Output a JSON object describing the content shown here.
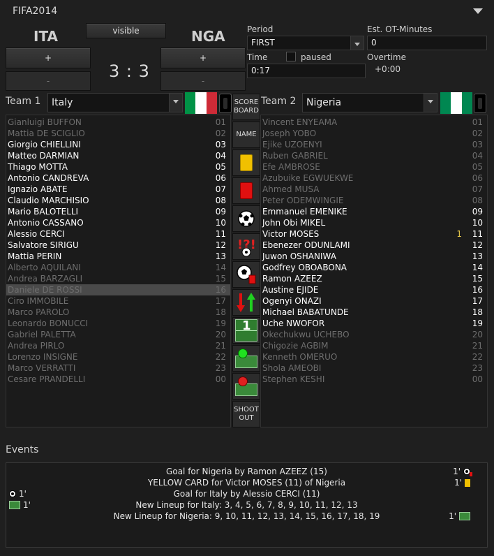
{
  "app": {
    "title": "FIFA2014"
  },
  "header": {
    "home_code": "ITA",
    "away_code": "NGA",
    "visible_label": "visible",
    "plus_label": "+",
    "minus_label": "-",
    "score": "3 : 3"
  },
  "period": {
    "label": "Period",
    "value": "FIRST"
  },
  "time": {
    "label": "Time",
    "value": "0:17",
    "paused_label": "paused",
    "paused": false
  },
  "ot_minutes": {
    "label": "Est. OT-Minutes",
    "value": "0"
  },
  "overtime": {
    "label": "Overtime",
    "value": "+0:00"
  },
  "team1": {
    "label": "Team 1",
    "name": "Italy",
    "flag_colors": [
      "#009246",
      "#ffffff",
      "#ce2b37"
    ],
    "players": [
      {
        "name": "Gianluigi BUFFON",
        "num": "01",
        "state": "inactive"
      },
      {
        "name": "Mattia DE SCIGLIO",
        "num": "02",
        "state": "inactive"
      },
      {
        "name": "Giorgio CHIELLINI",
        "num": "03",
        "state": "active"
      },
      {
        "name": "Matteo DARMIAN",
        "num": "04",
        "state": "active"
      },
      {
        "name": "Thiago MOTTA",
        "num": "05",
        "state": "active"
      },
      {
        "name": "Antonio CANDREVA",
        "num": "06",
        "state": "active"
      },
      {
        "name": "Ignazio ABATE",
        "num": "07",
        "state": "active"
      },
      {
        "name": "Claudio MARCHISIO",
        "num": "08",
        "state": "active"
      },
      {
        "name": "Mario BALOTELLI",
        "num": "09",
        "state": "active"
      },
      {
        "name": "Antonio CASSANO",
        "num": "10",
        "state": "active"
      },
      {
        "name": "Alessio CERCI",
        "num": "11",
        "state": "active"
      },
      {
        "name": "Salvatore SIRIGU",
        "num": "12",
        "state": "active"
      },
      {
        "name": "Mattia PERIN",
        "num": "13",
        "state": "active"
      },
      {
        "name": "Alberto AQUILANI",
        "num": "14",
        "state": "inactive"
      },
      {
        "name": "Andrea BARZAGLI",
        "num": "15",
        "state": "inactive"
      },
      {
        "name": "Daniele DE ROSSI",
        "num": "16",
        "state": "inactive",
        "selected": true
      },
      {
        "name": "Ciro IMMOBILE",
        "num": "17",
        "state": "inactive"
      },
      {
        "name": "Marco PAROLO",
        "num": "18",
        "state": "inactive"
      },
      {
        "name": "Leonardo BONUCCI",
        "num": "19",
        "state": "inactive"
      },
      {
        "name": "Gabriel PALETTA",
        "num": "20",
        "state": "inactive"
      },
      {
        "name": "Andrea PIRLO",
        "num": "21",
        "state": "inactive"
      },
      {
        "name": "Lorenzo INSIGNE",
        "num": "22",
        "state": "inactive"
      },
      {
        "name": "Marco VERRATTI",
        "num": "23",
        "state": "inactive"
      },
      {
        "name": "Cesare PRANDELLI",
        "num": "00",
        "state": "inactive"
      }
    ]
  },
  "team2": {
    "label": "Team 2",
    "name": "Nigeria",
    "flag_colors": [
      "#008751",
      "#ffffff",
      "#008751"
    ],
    "players": [
      {
        "name": "Vincent ENYEAMA",
        "num": "01",
        "state": "inactive"
      },
      {
        "name": "Joseph YOBO",
        "num": "02",
        "state": "inactive"
      },
      {
        "name": "Ejike UZOENYI",
        "num": "03",
        "state": "inactive"
      },
      {
        "name": "Ruben GABRIEL",
        "num": "04",
        "state": "inactive"
      },
      {
        "name": "Efe AMBROSE",
        "num": "05",
        "state": "inactive"
      },
      {
        "name": "Azubuike EGWUEKWE",
        "num": "06",
        "state": "inactive"
      },
      {
        "name": "Ahmed MUSA",
        "num": "07",
        "state": "inactive"
      },
      {
        "name": "Peter ODEMWINGIE",
        "num": "08",
        "state": "inactive"
      },
      {
        "name": "Emmanuel EMENIKE",
        "num": "09",
        "state": "active"
      },
      {
        "name": "John Obi MIKEL",
        "num": "10",
        "state": "active"
      },
      {
        "name": "Victor MOSES",
        "num": "11",
        "state": "active",
        "goals": "1"
      },
      {
        "name": "Ebenezer ODUNLAMI",
        "num": "12",
        "state": "active"
      },
      {
        "name": "Juwon OSHANIWA",
        "num": "13",
        "state": "active"
      },
      {
        "name": "Godfrey OBOABONA",
        "num": "14",
        "state": "active"
      },
      {
        "name": "Ramon AZEEZ",
        "num": "15",
        "state": "active"
      },
      {
        "name": "Austine EJIDE",
        "num": "16",
        "state": "active"
      },
      {
        "name": "Ogenyi ONAZI",
        "num": "17",
        "state": "active"
      },
      {
        "name": "Michael BABATUNDE",
        "num": "18",
        "state": "active"
      },
      {
        "name": "Uche NWOFOR",
        "num": "19",
        "state": "active"
      },
      {
        "name": "Okechukwu UCHEBO",
        "num": "20",
        "state": "inactive"
      },
      {
        "name": "Chigozie AGBIM",
        "num": "21",
        "state": "inactive"
      },
      {
        "name": "Kenneth OMERUO",
        "num": "22",
        "state": "inactive"
      },
      {
        "name": "Shola AMEOBI",
        "num": "23",
        "state": "inactive"
      },
      {
        "name": "Stephen KESHI",
        "num": "00",
        "state": "inactive"
      }
    ]
  },
  "tools": {
    "scoreboard_label_1": "SCORE",
    "scoreboard_label_2": "BOARD",
    "name_label": "NAME",
    "lineup_number": "1",
    "shootout_label_1": "SHOOT",
    "shootout_label_2": "OUT"
  },
  "events": {
    "label": "Events",
    "items": [
      {
        "text": "Goal for Nigeria by Ramon AZEEZ (15)",
        "side": "right",
        "minute": "1'",
        "icon": "ball-card-icon"
      },
      {
        "text": "YELLOW CARD for Victor MOSES (11) of Nigeria",
        "side": "right",
        "minute": "1'",
        "icon": "yellow-card-icon"
      },
      {
        "text": "Goal for Italy by Alessio CERCI (11)",
        "side": "left",
        "minute": "1'",
        "icon": "ball-icon"
      },
      {
        "text": "New Lineup for Italy: 3, 4, 5, 6, 7, 8, 9, 10, 11, 12, 13",
        "side": "left",
        "minute": "1'",
        "icon": "lineup-icon"
      },
      {
        "text": "New Lineup for Nigeria: 9, 10, 11, 12, 13, 14, 15, 16, 17, 18, 19",
        "side": "right",
        "minute": "1'",
        "icon": "lineup-icon"
      }
    ]
  }
}
